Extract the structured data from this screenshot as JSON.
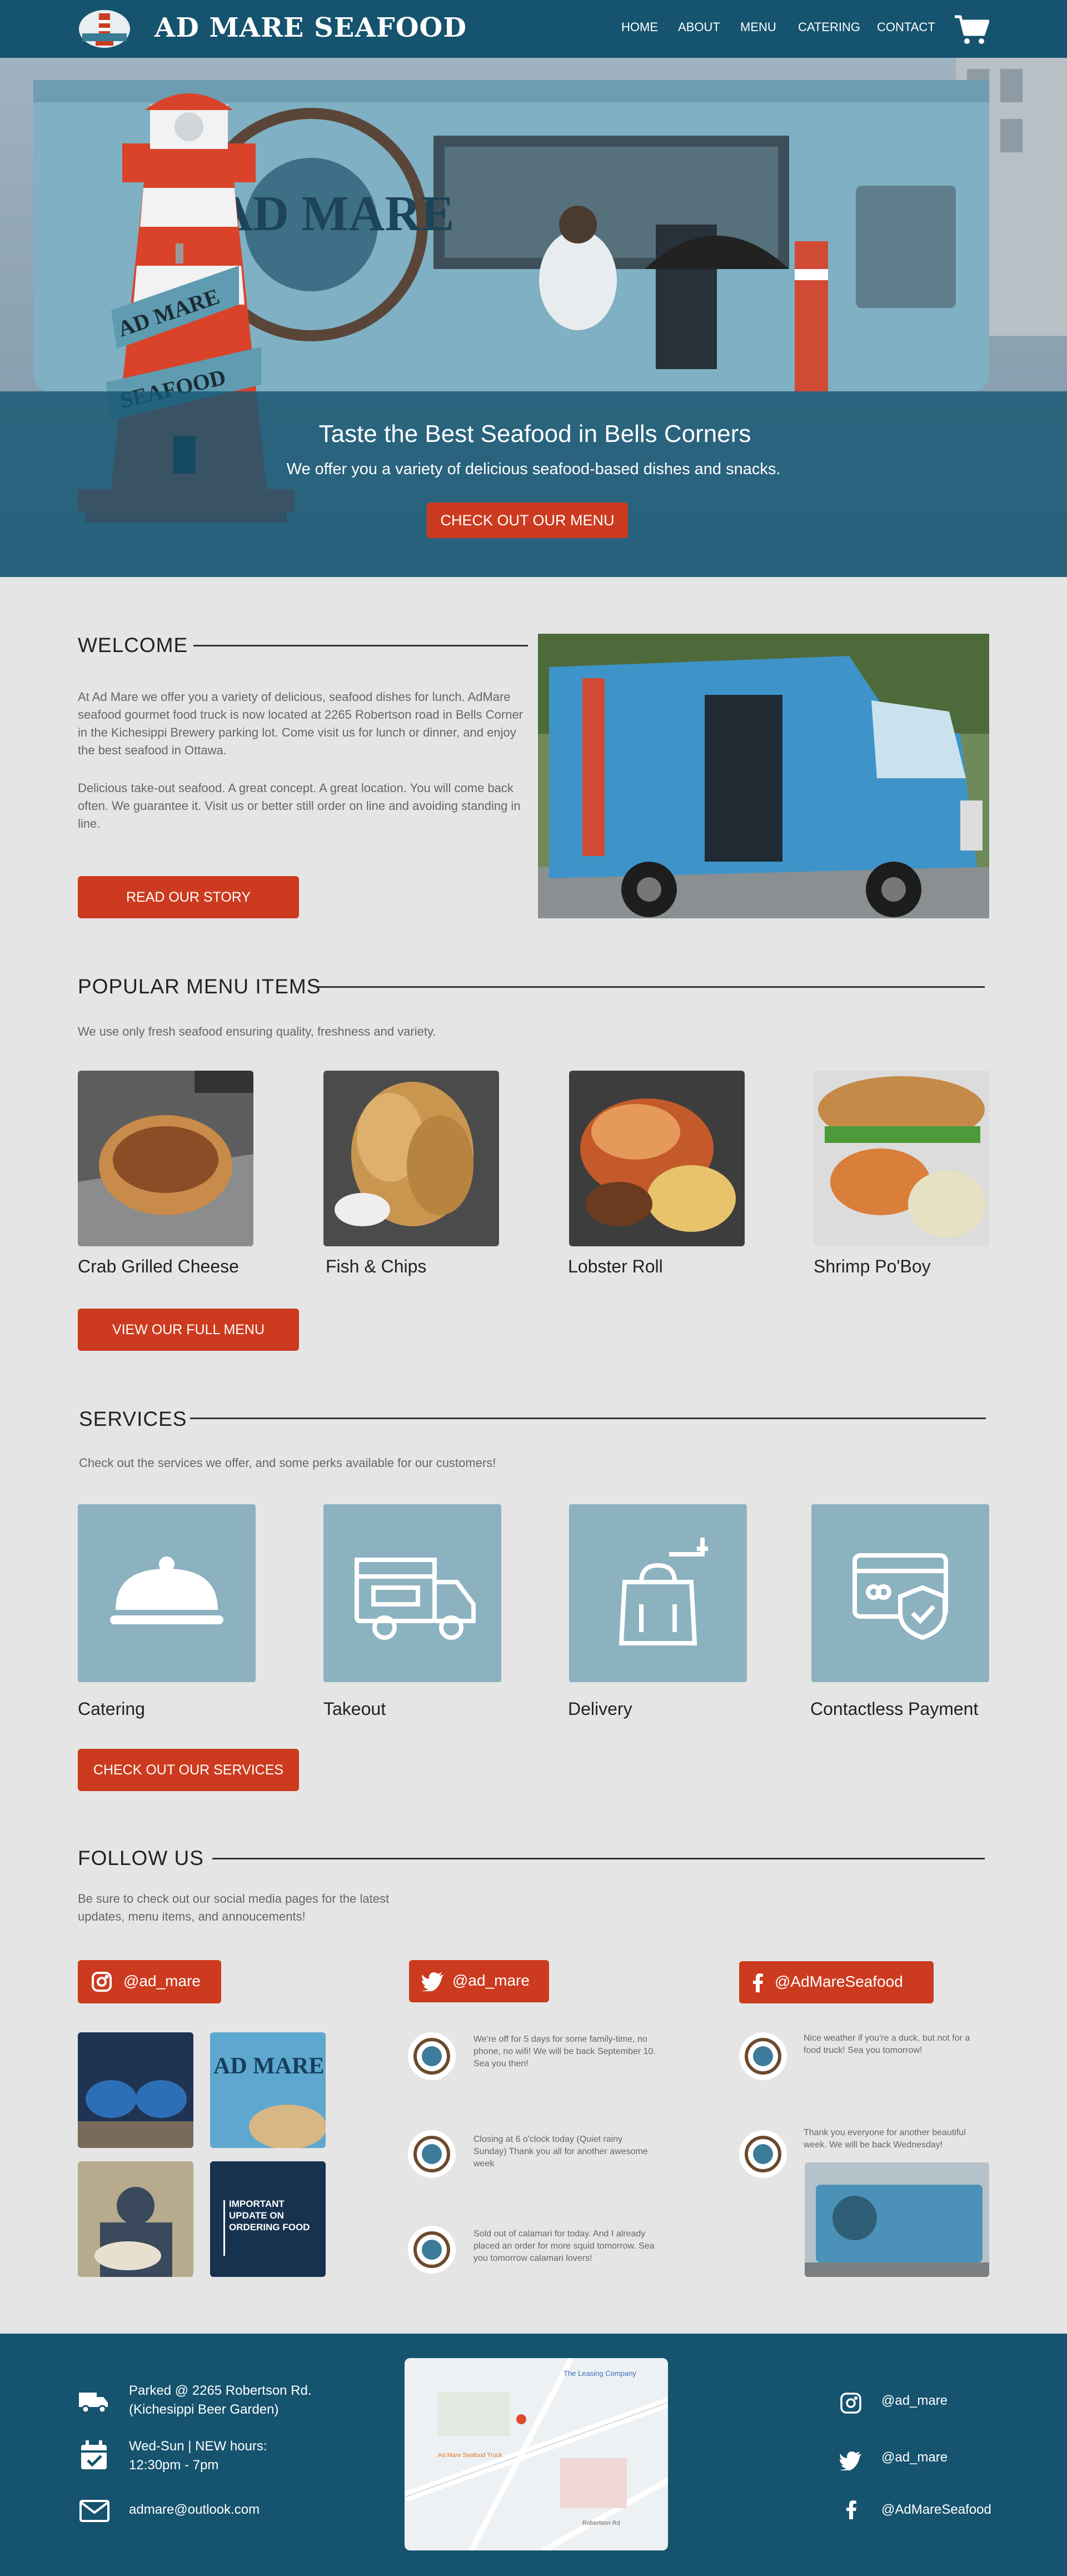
{
  "nav": {
    "brand": "AD MARE SEAFOOD",
    "links": [
      "HOME",
      "ABOUT",
      "MENU",
      "CATERING",
      "CONTACT"
    ]
  },
  "hero": {
    "sign_line1": "AD MARE",
    "sign_line2": "SEAFOOD",
    "truck_text": "AD MARE",
    "title": "Taste the Best Seafood in Bells Corners",
    "subtitle": "We offer you a variety of delicious seafood-based dishes and snacks.",
    "cta": "CHECK OUT OUR MENU"
  },
  "welcome": {
    "title": "WELCOME",
    "para1": "At Ad Mare we offer you a variety of delicious, seafood dishes for lunch. AdMare seafood gourmet food truck is now located at 2265 Robertson road in Bells Corner in the Kichesippi Brewery parking lot. Come visit us for lunch or dinner, and enjoy the best seafood in Ottawa.",
    "para2": "Delicious take-out seafood. A great concept. A great location. You will come back often. We guarantee it. Visit us or better still order on line and avoiding standing in line.",
    "cta": "READ OUR STORY"
  },
  "menu": {
    "title": "POPULAR MENU ITEMS",
    "intro": "We use only fresh seafood ensuring quality, freshness and variety.",
    "items": [
      "Crab Grilled Cheese",
      "Fish & Chips",
      "Lobster Roll",
      "Shrimp Po'Boy"
    ],
    "cta": "VIEW OUR FULL MENU"
  },
  "services": {
    "title": "SERVICES",
    "intro": "Check out the services we offer, and some perks available for our customers!",
    "items": [
      "Catering",
      "Takeout",
      "Delivery",
      "Contactless Payment"
    ],
    "cta": "CHECK OUT OUR SERVICES"
  },
  "follow": {
    "title": "FOLLOW US",
    "intro": "Be sure to check out our social media pages for the latest updates, menu items, and annoucements!",
    "instagram": "@ad_mare",
    "twitter": "@ad_mare",
    "facebook": "@AdMareSeafood",
    "ig_posts": [
      "",
      "AD MARE",
      "",
      "IMPORTANT UPDATE ON ORDERING FOOD"
    ],
    "tweets": [
      "We're off for 5 days for some family-time, no phone, no wifi! We will be back September 10. Sea you then!",
      "Closing at 6 o'clock today (Quiet rainy Sunday) Thank you all for another awesome week",
      "Sold out of calamari for today. And I already placed an order for more squid tomorrow. Sea you tomorrow calamari lovers!"
    ],
    "fb_posts": [
      "Nice weather if you're a duck, but not for a food truck! Sea you tomorrow!",
      "Thank you everyone for another beautiful week. We will be back Wednesday!"
    ]
  },
  "footer": {
    "address1": "Parked @ 2265 Robertson Rd.",
    "address2": "(Kichesippi Beer Garden)",
    "hours1": "Wed-Sun | NEW hours:",
    "hours2": "12:30pm - 7pm",
    "email": "admare@outlook.com",
    "map_label1": "The Leasing Company",
    "map_label2": "Ad Mare Seafood Truck",
    "map_label3": "Robertson Rd",
    "instagram": "@ad_mare",
    "twitter": "@ad_mare",
    "facebook": "@AdMareSeafood"
  },
  "colors": {
    "nav": "#15536e",
    "accent": "#cc3b1f",
    "service_tile": "#8cb2c0",
    "page_bg": "#e5e5e5"
  }
}
